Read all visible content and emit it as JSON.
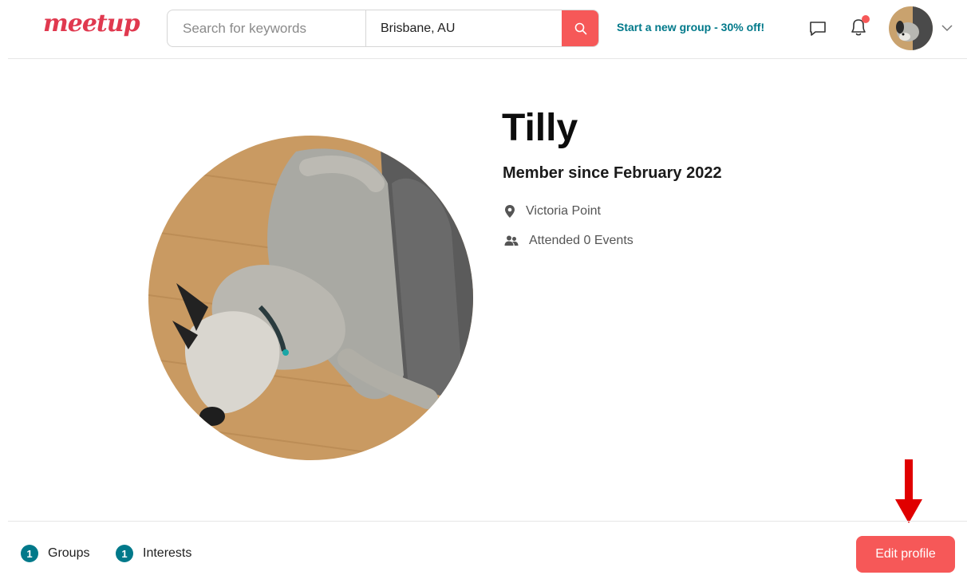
{
  "header": {
    "logo_text": "meetup",
    "search": {
      "placeholder": "Search for keywords",
      "value": ""
    },
    "location": {
      "value": "Brisbane, AU"
    },
    "promo_link": "Start a new group - 30% off!",
    "icons": [
      "search-icon",
      "chat-icon",
      "bell-icon",
      "avatar",
      "chevron-down-icon"
    ],
    "notification_dot": true
  },
  "profile": {
    "name": "Tilly",
    "member_since": "Member since February 2022",
    "location": "Victoria Point",
    "attended": "Attended 0 Events"
  },
  "footer": {
    "groups": {
      "count": "1",
      "label": "Groups"
    },
    "interests": {
      "count": "1",
      "label": "Interests"
    },
    "edit_button": "Edit profile"
  },
  "colors": {
    "brand": "#e0394f",
    "accent": "#f65858",
    "teal": "#00798a",
    "annotation_arrow": "#e00000"
  }
}
